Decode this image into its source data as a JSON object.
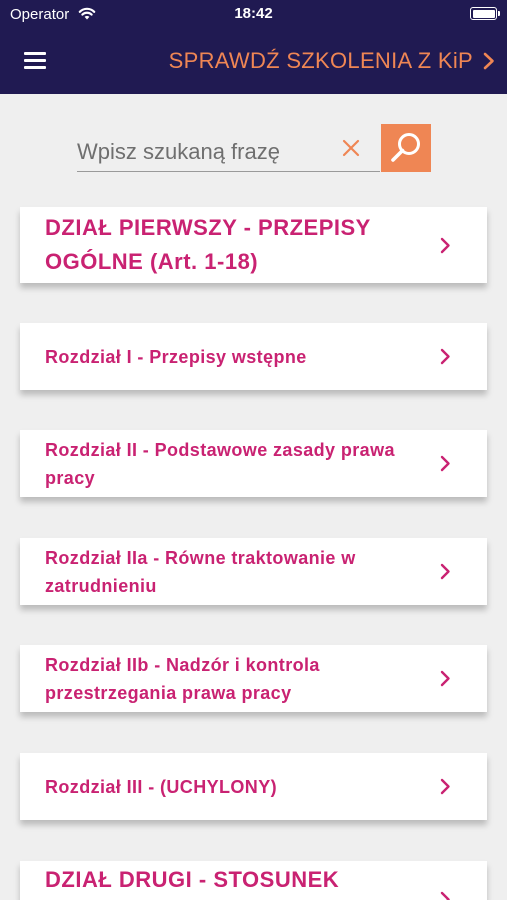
{
  "status_bar": {
    "carrier": "Operator",
    "time": "18:42",
    "wifi_icon": "wifi-icon",
    "battery_icon": "battery-icon"
  },
  "nav": {
    "menu_icon": "hamburger-menu-icon",
    "promo_label": "SPRAWDŹ SZKOLENIA Z KiP",
    "promo_icon": "chevron-right-icon"
  },
  "search": {
    "placeholder": "Wpisz szukaną frazę",
    "value": "",
    "clear_icon": "close-icon",
    "button_icon": "search-icon"
  },
  "list": {
    "items": [
      {
        "label": "DZIAŁ PIERWSZY - PRZEPISY OGÓLNE (Art. 1-18)",
        "kind": "section"
      },
      {
        "label": "Rozdział I - Przepisy wstępne",
        "kind": "chapter"
      },
      {
        "label": "Rozdział II - Podstawowe zasady prawa pracy",
        "kind": "chapter"
      },
      {
        "label": "Rozdział IIa - Równe traktowanie w zatrudnieniu",
        "kind": "chapter"
      },
      {
        "label": "Rozdział IIb - Nadzór i kontrola przestrzegania prawa pracy",
        "kind": "chapter"
      },
      {
        "label": "Rozdział III - (UCHYLONY)",
        "kind": "chapter"
      },
      {
        "label": "DZIAŁ DRUGI - STOSUNEK",
        "kind": "section"
      }
    ]
  },
  "colors": {
    "navbar_bg": "#201a52",
    "accent_orange": "#ef8654",
    "item_text": "#c92272",
    "page_bg": "#efefef"
  }
}
